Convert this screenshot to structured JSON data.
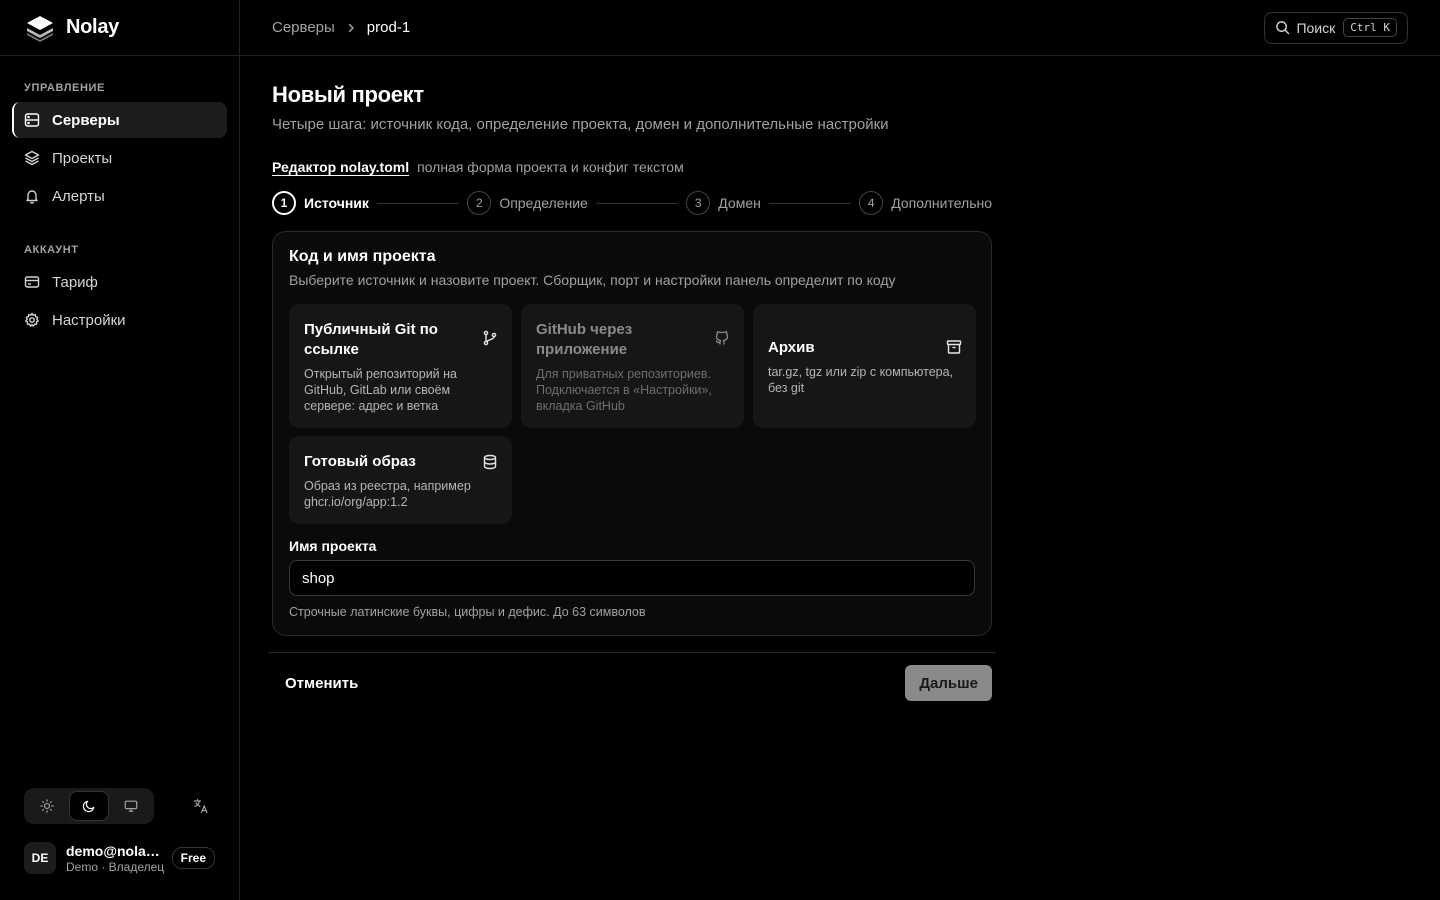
{
  "brand": {
    "name": "Nolay"
  },
  "sidebar": {
    "management_heading": "УПРАВЛЕНИЕ",
    "management_items": [
      {
        "label": "Серверы",
        "icon": "server-icon",
        "active": true
      },
      {
        "label": "Проекты",
        "icon": "layers-icon",
        "active": false
      },
      {
        "label": "Алерты",
        "icon": "bell-icon",
        "active": false
      }
    ],
    "account_heading": "АККАУНТ",
    "account_items": [
      {
        "label": "Тариф",
        "icon": "card-icon",
        "active": false
      },
      {
        "label": "Настройки",
        "icon": "gear-icon",
        "active": false
      }
    ],
    "theme": {
      "selected": "dark"
    },
    "user": {
      "initials": "DE",
      "email": "demo@nolay...",
      "subtitle": "Demo · Владелец",
      "plan": "Free"
    }
  },
  "topbar": {
    "breadcrumb": [
      "Серверы",
      "prod-1"
    ],
    "search_label": "Поиск",
    "search_shortcut": "Ctrl K"
  },
  "page": {
    "title": "Новый проект",
    "description": "Четыре шага: источник кода, определение проекта, домен и дополнительные настройки",
    "editor_link": "Редактор nolay.toml",
    "editor_desc": "полная форма проекта и конфиг текстом"
  },
  "steps": [
    {
      "num": "1",
      "label": "Источник",
      "active": true
    },
    {
      "num": "2",
      "label": "Определение",
      "active": false
    },
    {
      "num": "3",
      "label": "Домен",
      "active": false
    },
    {
      "num": "4",
      "label": "Дополнительно",
      "active": false
    }
  ],
  "card": {
    "title": "Код и имя проекта",
    "description": "Выберите источник и назовите проект. Сборщик, порт и настройки панель определит по коду",
    "options": [
      {
        "title": "Публичный Git по ссылке",
        "desc": "Открытый репозиторий на GitHub, GitLab или своём сервере: адрес и ветка",
        "icon": "git-branch-icon",
        "disabled": false
      },
      {
        "title": "GitHub через приложение",
        "desc": "Для приватных репозиториев. Подключается в «Настройки», вкладка GitHub",
        "icon": "github-icon",
        "disabled": true
      },
      {
        "title": "Архив",
        "desc": "tar.gz, tgz или zip с компьютера, без git",
        "icon": "archive-icon",
        "disabled": false
      },
      {
        "title": "Готовый образ",
        "desc": "Образ из реестра, например ghcr.io/org/app:1.2",
        "icon": "database-icon",
        "disabled": false
      }
    ],
    "name_label": "Имя проекта",
    "name_value": "shop",
    "name_hint": "Строчные латинские буквы, цифры и дефис. До 63 символов"
  },
  "footer": {
    "cancel_label": "Отменить",
    "next_label": "Дальше"
  }
}
